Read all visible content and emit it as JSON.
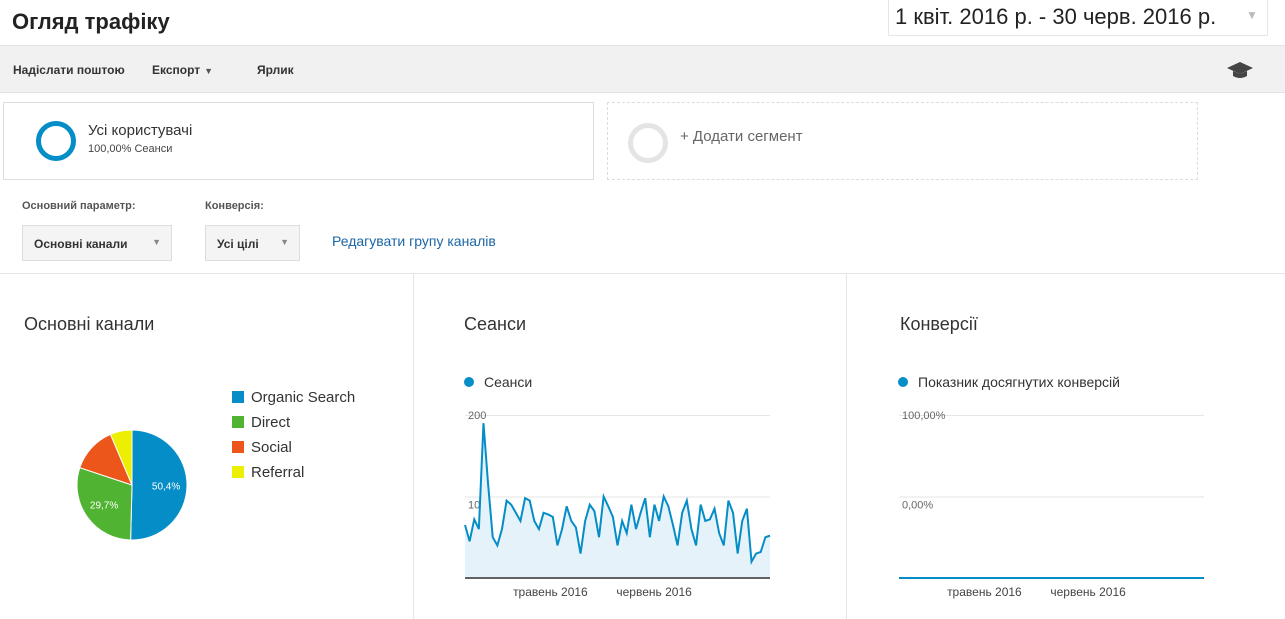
{
  "header": {
    "title": "Огляд трафіку",
    "date_range": "1 квіт. 2016 р. - 30 черв. 2016 р."
  },
  "toolbar": {
    "email_label": "Надіслати поштою",
    "export_label": "Експорт",
    "shortcut_label": "Ярлик",
    "icon": "graduation-cap-icon"
  },
  "segments": {
    "active": {
      "name": "Усі користувачі",
      "sub": "100,00% Сеанси"
    },
    "add_label": "+ Додати сегмент"
  },
  "controls": {
    "primary_dim_label": "Основний параметр:",
    "primary_dim_value": "Основні канали",
    "conversion_label": "Конверсія:",
    "conversion_value": "Усі цілі",
    "edit_link": "Редагувати групу каналів"
  },
  "cards": {
    "channels_title": "Основні канали",
    "sessions_title": "Сеанси",
    "conversions_title": "Конверсії"
  },
  "colors": {
    "accent": "#058dc7",
    "organic": "#058dc7",
    "direct": "#50b432",
    "social": "#ed561b",
    "referral": "#edef00"
  },
  "chart_data": [
    {
      "type": "pie",
      "series": [
        {
          "name": "Organic Search",
          "value": 50.4,
          "label": "50,4%"
        },
        {
          "name": "Direct",
          "value": 29.7,
          "label": "29,7%"
        },
        {
          "name": "Social",
          "value": 13.5,
          "label": ""
        },
        {
          "name": "Referral",
          "value": 6.4,
          "label": ""
        }
      ]
    },
    {
      "type": "area",
      "series": [
        {
          "name": "Сеанси",
          "values": [
            65,
            45,
            72,
            60,
            190,
            115,
            50,
            40,
            60,
            95,
            90,
            80,
            70,
            98,
            95,
            70,
            60,
            80,
            78,
            75,
            40,
            60,
            88,
            70,
            62,
            30,
            70,
            90,
            82,
            50,
            100,
            88,
            75,
            40,
            70,
            55,
            90,
            60,
            80,
            98,
            50,
            90,
            70,
            100,
            88,
            65,
            40,
            80,
            95,
            60,
            40,
            90,
            70,
            72,
            85,
            55,
            40,
            95,
            80,
            30,
            70,
            85,
            20,
            30,
            32,
            50,
            52
          ]
        }
      ],
      "yticks": [
        "200",
        "100"
      ],
      "ylim": [
        0,
        200
      ],
      "xticks": [
        "травень 2016",
        "червень 2016"
      ]
    },
    {
      "type": "line",
      "series": [
        {
          "name": "Показник досягнутих конверсій",
          "values": [
            0,
            0
          ]
        }
      ],
      "yticks": [
        "100,00%",
        "0,00%"
      ],
      "ylim": [
        0,
        100
      ],
      "xticks": [
        "травень 2016",
        "червень 2016"
      ]
    }
  ]
}
